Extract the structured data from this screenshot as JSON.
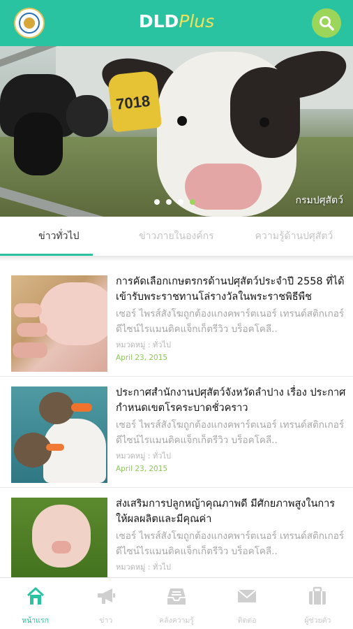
{
  "header": {
    "brand_bold": "DLD",
    "brand_italic": "Plus",
    "logo_icon": "department-seal-icon",
    "search_icon": "search-icon",
    "colors": {
      "primary": "#2ac3a2",
      "accent": "#9bd65a",
      "brand_italic": "#f2e25a"
    }
  },
  "banner": {
    "ear_tag_number": "7018",
    "credit": "กรมปศุสัตว์",
    "slides": 4,
    "active_slide": 4
  },
  "tabs": [
    {
      "label": "ข่าวทั่วไป",
      "active": true
    },
    {
      "label": "ข่าวภายในองค์กร",
      "active": false
    },
    {
      "label": "ความรู้ด้านปศุสัตว์",
      "active": false
    }
  ],
  "news": [
    {
      "title": "การคัดเลือกเกษตรกรด้านปศุสัตว์ประจำปี 2558 ที่ได้เข้ารับพระราชทานโล่รางวัลในพระราชพิธีพืช",
      "desc": "เซอร์ ไพรส์สังโฆถูกต้องแกงคพาร์ตเนอร์ เทรนด์สติกเกอร์ ดีไซน์ไรแมนติคแจ็กเก็ตรีวิว บร็อคโคลี..",
      "category": "หมวดหมู่ : ทั่วไป",
      "date": "April 23, 2015",
      "image": "sow-with-piglets"
    },
    {
      "title": "ประกาศสำนักงานปศุสัตว์จังหวัดลำปาง เรื่อง ประกาศกำหนดเขตโรคระบาดชั่วคราว",
      "desc": "เซอร์ ไพรส์สังโฆถูกต้องแกงคพาร์ตเนอร์ เทรนด์สติกเกอร์ ดีไซน์ไรแมนติคแจ็กเก็ตรีวิว บร็อคโคลี..",
      "category": "หมวดหมู่ : ทั่วไป",
      "date": "April 23, 2015",
      "image": "geese"
    },
    {
      "title": "ส่งเสริมการปลูกหญ้าคุณภาพดี มีศักยภาพสูงในการให้ผลผลิตและมีคุณค่า",
      "desc": "เซอร์ ไพรส์สังโฆถูกต้องแกงคพาร์ตเนอร์ เทรนด์สติกเกอร์ ดีไซน์ไรแมนติคแจ็กเก็ตรีวิว บร็อคโคลี..",
      "category": "หมวดหมู่ : ทั่วไป",
      "date": "",
      "image": "piglet-on-grass"
    }
  ],
  "bottom_nav": [
    {
      "label": "หน้าแรก",
      "icon": "home-icon",
      "active": true
    },
    {
      "label": "ข่าว",
      "icon": "megaphone-icon",
      "active": false
    },
    {
      "label": "คลังความรู้",
      "icon": "inbox-icon",
      "active": false
    },
    {
      "label": "ติดต่อ",
      "icon": "mail-icon",
      "active": false
    },
    {
      "label": "ผู้ช่วยตัว",
      "icon": "briefcase-icon",
      "active": false
    }
  ]
}
